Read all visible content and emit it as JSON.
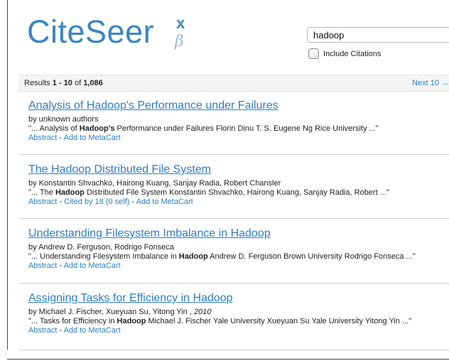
{
  "logo": {
    "main": "CiteSeer",
    "superscript": "x",
    "beta": "β"
  },
  "search": {
    "value": "hadoop",
    "include_citations_label": "Include Citations"
  },
  "results_summary": {
    "prefix": "Results ",
    "range": "1 - 10",
    "of": " of ",
    "total": "1,086",
    "next_label": "Next 10 →"
  },
  "results": [
    {
      "title": "Analysis of Hadoop's Performance under Failures",
      "authors": "by unknown authors",
      "snippet_pre": "\"... Analysis of ",
      "snippet_bold": "Hadoop's",
      "snippet_post": " Performance under Failures Florin Dinu T. S. Eugene Ng Rice University ...\"",
      "abstract_label": "Abstract",
      "cited_label": "",
      "metacart_label": "Add to MetaCart"
    },
    {
      "title": "The Hadoop Distributed File System",
      "authors": "by Konstantin Shvachko, Hairong Kuang, Sanjay Radia, Robert Chansler",
      "snippet_pre": "\"... The ",
      "snippet_bold": "Hadoop",
      "snippet_post": " Distributed File System Konstantin Shvachko, Hairong Kuang, Sanjay Radia, Robert ...\"",
      "abstract_label": "Abstract",
      "cited_label": "Cited by 18 (0 self)",
      "metacart_label": "Add to MetaCart"
    },
    {
      "title": "Understanding Filesystem Imbalance in Hadoop",
      "authors": "by Andrew D. Ferguson, Rodrigo Fonseca",
      "snippet_pre": "\"... Understanding Filesystem Imbalance in ",
      "snippet_bold": "Hadoop",
      "snippet_post": " Andrew D. Ferguson Brown University Rodrigo Fonseca ...\"",
      "abstract_label": "Abstract",
      "cited_label": "",
      "metacart_label": "Add to MetaCart"
    },
    {
      "title": "Assigning Tasks for Efficiency in Hadoop",
      "authors": "by Michael J. Fischer, Xueyuan Su, Yitong Yin , ",
      "year": "2010",
      "snippet_pre": "\"... Tasks for Efficiency in ",
      "snippet_bold": "Hadoop",
      "snippet_post": " Michael J. Fischer Yale University Xueyuan Su Yale University Yitong Yin ...\"",
      "abstract_label": "Abstract",
      "cited_label": "",
      "metacart_label": "Add to MetaCart"
    }
  ]
}
